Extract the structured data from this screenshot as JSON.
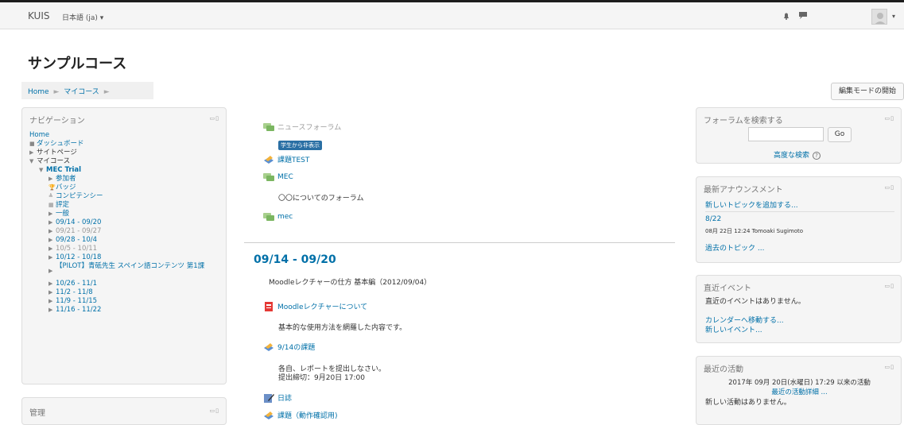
{
  "navbar": {
    "brand": "KUIS",
    "language": "日本語 (ja) ▾",
    "avatar_caret": "▾"
  },
  "page": {
    "title": "サンプルコース"
  },
  "breadcrumb": {
    "items": [
      "Home",
      "マイコース"
    ],
    "separator": "►"
  },
  "edit_button": "編集モードの開始",
  "navigation": {
    "title": "ナビゲーション",
    "items": [
      {
        "label": "Home",
        "marker": ""
      },
      {
        "label": "ダッシュボード",
        "marker": "■"
      },
      {
        "label": "サイトページ",
        "marker": "▶"
      },
      {
        "label": "マイコース",
        "marker": "▼"
      },
      {
        "label": "MEC Trial",
        "marker": "▼"
      },
      {
        "label": "参加者",
        "marker": "▶"
      },
      {
        "label": "バッジ",
        "marker": "🏆"
      },
      {
        "label": "コンピテンシー",
        "marker": "≜"
      },
      {
        "label": "評定",
        "marker": "▦"
      },
      {
        "label": "一般",
        "marker": "▶"
      },
      {
        "label": "09/14 - 09/20",
        "marker": "▶"
      },
      {
        "label": "09/21 - 09/27",
        "marker": "▶"
      },
      {
        "label": "09/28 - 10/4",
        "marker": "▶"
      },
      {
        "label": "10/5 - 10/11",
        "marker": "▶"
      },
      {
        "label": "10/12 - 10/18",
        "marker": "▶"
      },
      {
        "label": "【PILOT】青砥先生 スペイン語コンテンツ 第1課",
        "marker": "▶"
      },
      {
        "label": "10/26 - 11/1",
        "marker": "▶"
      },
      {
        "label": "11/2 - 11/8",
        "marker": "▶"
      },
      {
        "label": "11/9 - 11/15",
        "marker": "▶"
      },
      {
        "label": "11/16 - 11/22",
        "marker": "▶"
      }
    ]
  },
  "admin": {
    "title": "管理"
  },
  "block_controls": "▭▯",
  "main": {
    "activities_top": [
      {
        "label": "ニュースフォーラム",
        "icon": "forum-icon"
      },
      {
        "label": "課題TEST",
        "icon": "assignment-icon"
      },
      {
        "label": "MEC",
        "icon": "forum-icon"
      },
      {
        "label": "mec",
        "icon": "forum-icon"
      }
    ],
    "hidden_badge": "学生から非表示",
    "mec_description": "〇〇についてのフォーラム",
    "section_title": "09/14 - 09/20",
    "section_summary": "Moodleレクチャーの仕方 基本編（2012/09/04）",
    "activities_section": [
      {
        "label": "Moodleレクチャーについて",
        "icon": "pdf-icon"
      },
      {
        "label": "9/14の課題",
        "icon": "assignment-icon"
      },
      {
        "label": "日誌",
        "icon": "journal-icon"
      },
      {
        "label": "課題（動作確認用)",
        "icon": "assignment-icon"
      }
    ],
    "lecture_description": "基本的な使用方法を網羅した内容です。",
    "assignment_description": "各自、レポートを提出しなさい。",
    "assignment_due": "提出締切：9月20日 17:00"
  },
  "search_forums": {
    "title": "フォーラムを検索する",
    "go_label": "Go",
    "advanced_label": "高度な検索",
    "help": "?"
  },
  "latest_news": {
    "title": "最新アナウンスメント",
    "add_topic": "新しいトピックを追加する...",
    "date": "8/22",
    "info": "08月 22日 12:24  Tomoaki Sugimoto",
    "older_topics": "過去のトピック ..."
  },
  "upcoming_events": {
    "title": "直近イベント",
    "none": "直近のイベントはありません。",
    "goto_calendar": "カレンダーへ移動する...",
    "new_event": "新しいイベント..."
  },
  "recent_activity": {
    "title": "最近の活動",
    "since": "2017年 09月 20日(水曜日) 17:29 以来の活動",
    "full_report": "最近の活動詳細 ...",
    "none": "新しい活動はありません。"
  }
}
